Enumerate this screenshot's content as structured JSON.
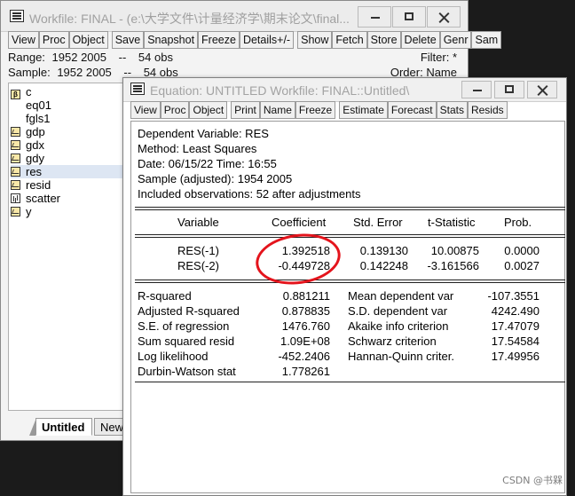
{
  "workfile": {
    "title": "Workfile: FINAL - (e:\\大学文件\\计量经济学\\期末论文\\final...",
    "toolbar": [
      "View",
      "Proc",
      "Object",
      "Save",
      "Snapshot",
      "Freeze",
      "Details+/-",
      "Show",
      "Fetch",
      "Store",
      "Delete",
      "Genr",
      "Sam"
    ],
    "range_label": "Range:",
    "range_value": "1952 2005",
    "range_sep": "--",
    "range_obs": "54 obs",
    "filter": "Filter: *",
    "sample_label": "Sample:",
    "sample_value": "1952 2005",
    "sample_sep": "--",
    "sample_obs": "54 obs",
    "order": "Order: Name",
    "objects": [
      {
        "name": "c",
        "type": "coef-icon"
      },
      {
        "name": "eq01",
        "type": "equation-icon"
      },
      {
        "name": "fgls1",
        "type": "equation-icon"
      },
      {
        "name": "gdp",
        "type": "series-icon"
      },
      {
        "name": "gdx",
        "type": "series-icon"
      },
      {
        "name": "gdy",
        "type": "series-icon"
      },
      {
        "name": "res",
        "type": "series-icon"
      },
      {
        "name": "resid",
        "type": "series-icon"
      },
      {
        "name": "scatter",
        "type": "graph-icon"
      },
      {
        "name": "y",
        "type": "series-icon"
      }
    ],
    "tabs": [
      "Untitled",
      "New"
    ]
  },
  "equation": {
    "title": "Equation: UNTITLED   Workfile: FINAL::Untitled\\",
    "toolbar": [
      "View",
      "Proc",
      "Object",
      "Print",
      "Name",
      "Freeze",
      "Estimate",
      "Forecast",
      "Stats",
      "Resids"
    ],
    "header": [
      "Dependent Variable: RES",
      "Method: Least Squares",
      "Date: 06/15/22   Time: 16:55",
      "Sample (adjusted): 1954 2005",
      "Included observations: 52 after adjustments"
    ],
    "columns": [
      "Variable",
      "Coefficient",
      "Std. Error",
      "t-Statistic",
      "Prob."
    ],
    "rows": [
      {
        "variable": "RES(-1)",
        "coefficient": "1.392518",
        "std_error": "0.139130",
        "t_stat": "10.00875",
        "prob": "0.0000"
      },
      {
        "variable": "RES(-2)",
        "coefficient": "-0.449728",
        "std_error": "0.142248",
        "t_stat": "-3.161566",
        "prob": "0.0027"
      }
    ],
    "stats_left": [
      {
        "label": "R-squared",
        "value": "0.881211"
      },
      {
        "label": "Adjusted R-squared",
        "value": "0.878835"
      },
      {
        "label": "S.E. of regression",
        "value": "1476.760"
      },
      {
        "label": "Sum squared resid",
        "value": "1.09E+08"
      },
      {
        "label": "Log likelihood",
        "value": "-452.2406"
      },
      {
        "label": "Durbin-Watson stat",
        "value": "1.778261"
      }
    ],
    "stats_right": [
      {
        "label": "Mean dependent var",
        "value": "-107.3551"
      },
      {
        "label": "S.D. dependent var",
        "value": "4242.490"
      },
      {
        "label": "Akaike info criterion",
        "value": "17.47079"
      },
      {
        "label": "Schwarz criterion",
        "value": "17.54584"
      },
      {
        "label": "Hannan-Quinn criter.",
        "value": "17.49956"
      }
    ]
  },
  "watermark": "CSDN @书槑",
  "colors": {
    "annotation_circle": "#e4141c"
  }
}
